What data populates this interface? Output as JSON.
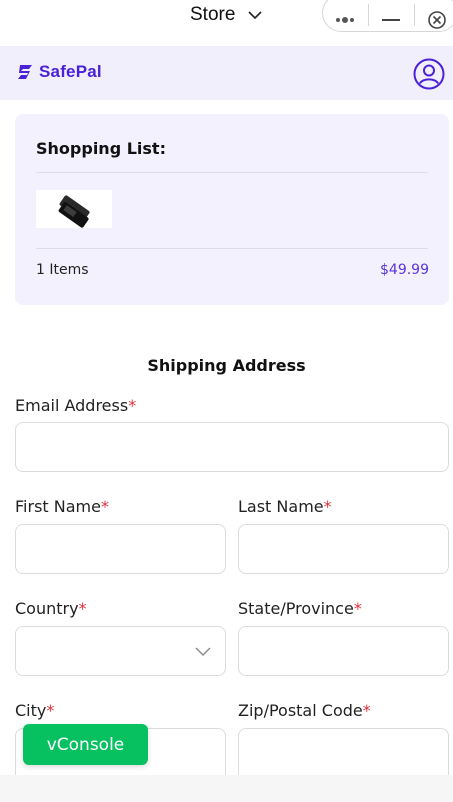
{
  "topbar": {
    "title": "Store",
    "chevron_icon": "chevron-down-icon",
    "capsule": {
      "more_icon": "more-dots-icon",
      "minimize_icon": "minimize-icon",
      "close_icon": "close-circle-icon"
    }
  },
  "brand": {
    "name": "SafePal",
    "logo_icon": "safepal-logo-icon",
    "user_icon": "user-account-icon",
    "color": "#4a21d6"
  },
  "cart": {
    "title": "Shopping List:",
    "product_image": "hardware-wallet-product",
    "items_text": "1 Items",
    "price": "$49.99",
    "price_color": "#5a34d8"
  },
  "shipping": {
    "title": "Shipping Address",
    "fields": {
      "email": {
        "label": "Email Address",
        "required_mark": "*",
        "value": ""
      },
      "first_name": {
        "label": "First Name",
        "required_mark": "*",
        "value": ""
      },
      "last_name": {
        "label": "Last Name",
        "required_mark": "*",
        "value": ""
      },
      "country": {
        "label": "Country",
        "required_mark": "*",
        "value": ""
      },
      "state": {
        "label": "State/Province",
        "required_mark": "*",
        "value": ""
      },
      "city": {
        "label": "City",
        "required_mark": "*",
        "value": ""
      },
      "zip": {
        "label": "Zip/Postal Code",
        "required_mark": "*",
        "value": ""
      }
    }
  },
  "vconsole": {
    "label": "vConsole",
    "color": "#07c160"
  }
}
